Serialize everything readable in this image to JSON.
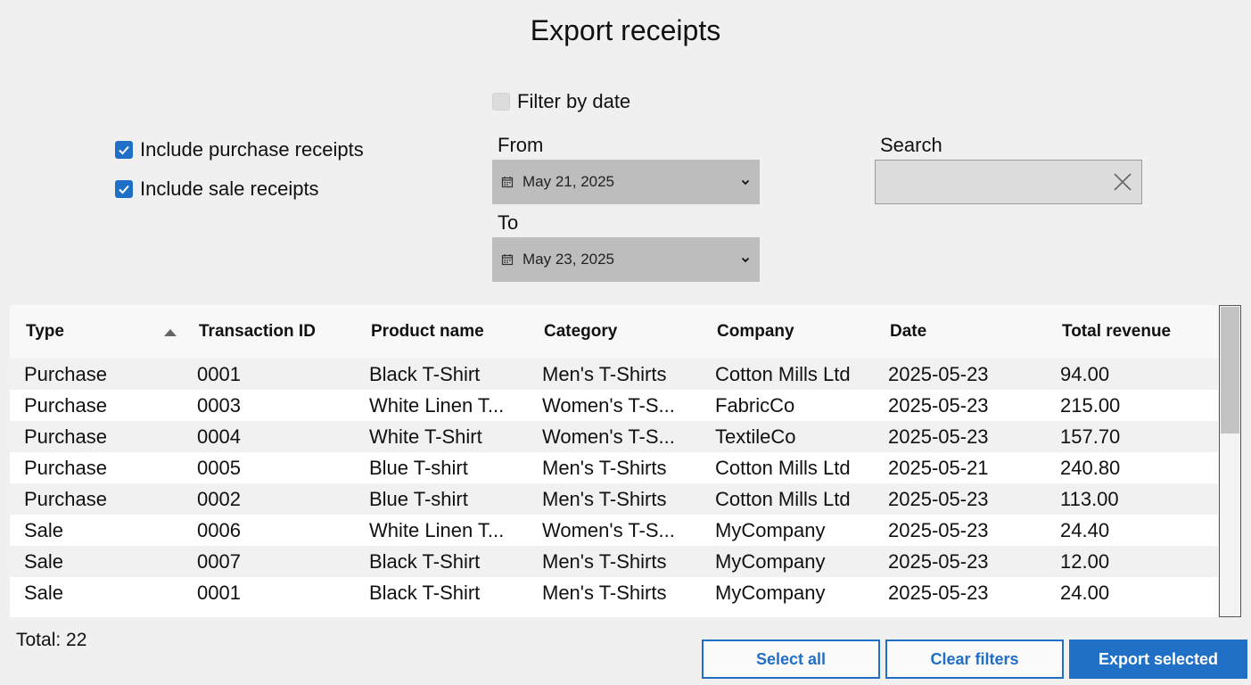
{
  "title": "Export receipts",
  "filters": {
    "include_purchase": {
      "label": "Include purchase receipts",
      "checked": true
    },
    "include_sale": {
      "label": "Include sale receipts",
      "checked": true
    },
    "filter_by_date": {
      "label": "Filter by date",
      "checked": false
    },
    "from_label": "From",
    "from_value": "May 21, 2025",
    "to_label": "To",
    "to_value": "May 23, 2025",
    "search_label": "Search",
    "search_value": ""
  },
  "table": {
    "columns": [
      "Type",
      "Transaction ID",
      "Product name",
      "Category",
      "Company",
      "Date",
      "Total revenue"
    ],
    "sort_column": "Type",
    "sort_direction": "ascending",
    "rows": [
      [
        "Purchase",
        "0001",
        "Black T-Shirt",
        "Men's T-Shirts",
        "Cotton Mills Ltd",
        "2025-05-23",
        "94.00"
      ],
      [
        "Purchase",
        "0003",
        "White Linen T...",
        "Women's T-S...",
        "FabricCo",
        "2025-05-23",
        "215.00"
      ],
      [
        "Purchase",
        "0004",
        "White T-Shirt",
        "Women's T-S...",
        "TextileCo",
        "2025-05-23",
        "157.70"
      ],
      [
        "Purchase",
        "0005",
        "Blue T-shirt",
        "Men's T-Shirts",
        "Cotton Mills Ltd",
        "2025-05-21",
        "240.80"
      ],
      [
        "Purchase",
        "0002",
        "Blue T-shirt",
        "Men's T-Shirts",
        "Cotton Mills Ltd",
        "2025-05-23",
        "113.00"
      ],
      [
        "Sale",
        "0006",
        "White Linen T...",
        "Women's T-S...",
        "MyCompany",
        "2025-05-23",
        "24.40"
      ],
      [
        "Sale",
        "0007",
        "Black T-Shirt",
        "Men's T-Shirts",
        "MyCompany",
        "2025-05-23",
        "12.00"
      ],
      [
        "Sale",
        "0001",
        "Black T-Shirt",
        "Men's T-Shirts",
        "MyCompany",
        "2025-05-23",
        "24.00"
      ]
    ]
  },
  "total_text": "Total: 22",
  "buttons": {
    "select_all": "Select all",
    "clear_filters": "Clear filters",
    "export_selected": "Export selected"
  },
  "colors": {
    "accent": "#1f6fc6",
    "background": "#f0f0f0",
    "date_picker_bg": "#bdbdbd"
  },
  "icons": {
    "checkbox_checked": "checkmark-icon",
    "date_picker": "calendar-icon",
    "dropdown": "chevron-down-icon",
    "search_clear": "close-icon",
    "sort": "sort-ascending-icon"
  }
}
